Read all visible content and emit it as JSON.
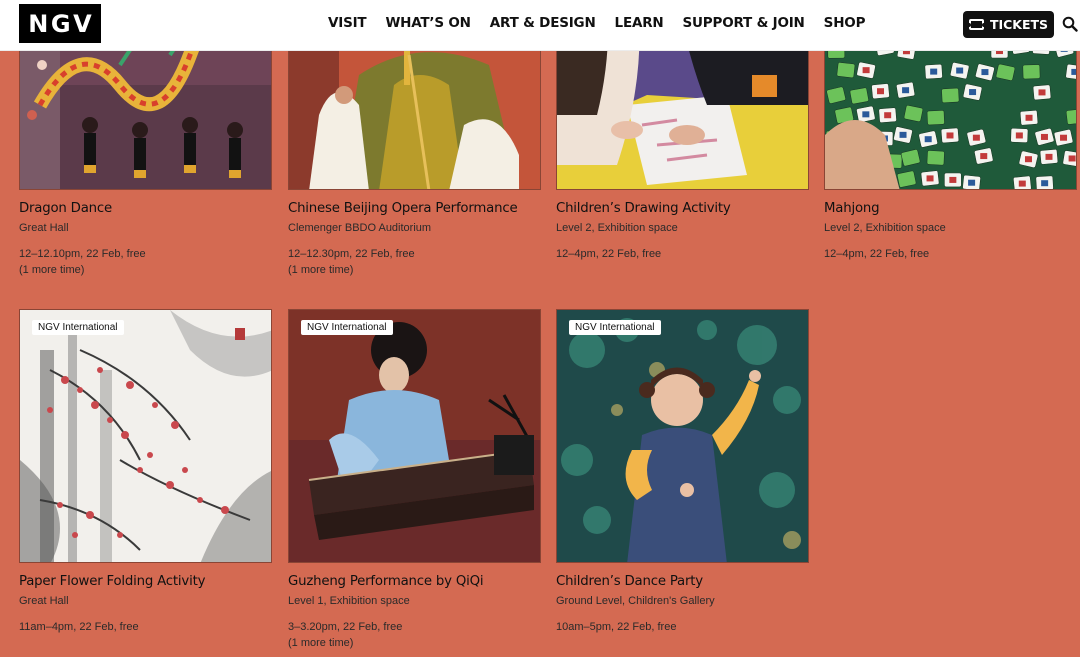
{
  "header": {
    "logo_letters": [
      "N",
      "G",
      "V"
    ],
    "nav": [
      "VISIT",
      "WHAT’S ON",
      "ART & DESIGN",
      "LEARN",
      "SUPPORT & JOIN",
      "SHOP"
    ],
    "tickets_label": "TICKETS"
  },
  "events": [
    {
      "title": "Dragon Dance",
      "venue": "Great Hall",
      "time": "12–12.10pm, 22 Feb, free",
      "more": "(1 more time)"
    },
    {
      "title": "Chinese Beijing Opera Performance",
      "venue": "Clemenger BBDO Auditorium",
      "time": "12–12.30pm, 22 Feb, free",
      "more": "(1 more time)"
    },
    {
      "title": "Children’s Drawing Activity",
      "venue": "Level 2, Exhibition space",
      "time": "12–4pm, 22 Feb, free"
    },
    {
      "title": "Mahjong",
      "venue": "Level 2, Exhibition space",
      "time": "12–4pm, 22 Feb, free"
    },
    {
      "badge": "NGV International",
      "title": "Paper Flower Folding Activity",
      "venue": "Great Hall",
      "time": "11am–4pm, 22 Feb, free"
    },
    {
      "badge": "NGV International",
      "title": "Guzheng Performance by QiQi",
      "venue": "Level 1, Exhibition space",
      "time": "3–3.20pm, 22 Feb, free",
      "more": "(1 more time)"
    },
    {
      "badge": "NGV International",
      "title": "Children’s Dance Party",
      "venue": "Ground Level, Children's Gallery",
      "time": "10am–5pm, 22 Feb, free"
    }
  ]
}
